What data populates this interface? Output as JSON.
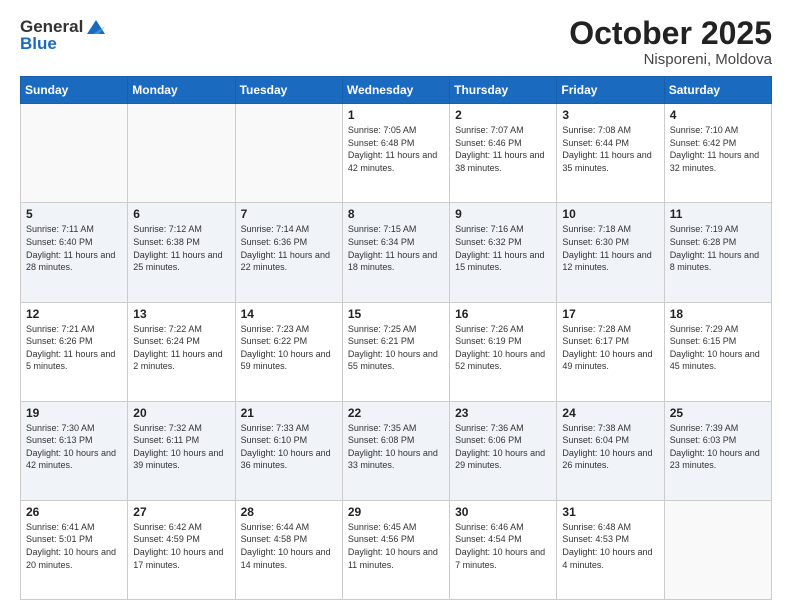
{
  "header": {
    "logo_general": "General",
    "logo_blue": "Blue",
    "title": "October 2025",
    "subtitle": "Nisporeni, Moldova"
  },
  "weekdays": [
    "Sunday",
    "Monday",
    "Tuesday",
    "Wednesday",
    "Thursday",
    "Friday",
    "Saturday"
  ],
  "weeks": [
    [
      {
        "day": "",
        "info": ""
      },
      {
        "day": "",
        "info": ""
      },
      {
        "day": "",
        "info": ""
      },
      {
        "day": "1",
        "info": "Sunrise: 7:05 AM\nSunset: 6:48 PM\nDaylight: 11 hours and 42 minutes."
      },
      {
        "day": "2",
        "info": "Sunrise: 7:07 AM\nSunset: 6:46 PM\nDaylight: 11 hours and 38 minutes."
      },
      {
        "day": "3",
        "info": "Sunrise: 7:08 AM\nSunset: 6:44 PM\nDaylight: 11 hours and 35 minutes."
      },
      {
        "day": "4",
        "info": "Sunrise: 7:10 AM\nSunset: 6:42 PM\nDaylight: 11 hours and 32 minutes."
      }
    ],
    [
      {
        "day": "5",
        "info": "Sunrise: 7:11 AM\nSunset: 6:40 PM\nDaylight: 11 hours and 28 minutes."
      },
      {
        "day": "6",
        "info": "Sunrise: 7:12 AM\nSunset: 6:38 PM\nDaylight: 11 hours and 25 minutes."
      },
      {
        "day": "7",
        "info": "Sunrise: 7:14 AM\nSunset: 6:36 PM\nDaylight: 11 hours and 22 minutes."
      },
      {
        "day": "8",
        "info": "Sunrise: 7:15 AM\nSunset: 6:34 PM\nDaylight: 11 hours and 18 minutes."
      },
      {
        "day": "9",
        "info": "Sunrise: 7:16 AM\nSunset: 6:32 PM\nDaylight: 11 hours and 15 minutes."
      },
      {
        "day": "10",
        "info": "Sunrise: 7:18 AM\nSunset: 6:30 PM\nDaylight: 11 hours and 12 minutes."
      },
      {
        "day": "11",
        "info": "Sunrise: 7:19 AM\nSunset: 6:28 PM\nDaylight: 11 hours and 8 minutes."
      }
    ],
    [
      {
        "day": "12",
        "info": "Sunrise: 7:21 AM\nSunset: 6:26 PM\nDaylight: 11 hours and 5 minutes."
      },
      {
        "day": "13",
        "info": "Sunrise: 7:22 AM\nSunset: 6:24 PM\nDaylight: 11 hours and 2 minutes."
      },
      {
        "day": "14",
        "info": "Sunrise: 7:23 AM\nSunset: 6:22 PM\nDaylight: 10 hours and 59 minutes."
      },
      {
        "day": "15",
        "info": "Sunrise: 7:25 AM\nSunset: 6:21 PM\nDaylight: 10 hours and 55 minutes."
      },
      {
        "day": "16",
        "info": "Sunrise: 7:26 AM\nSunset: 6:19 PM\nDaylight: 10 hours and 52 minutes."
      },
      {
        "day": "17",
        "info": "Sunrise: 7:28 AM\nSunset: 6:17 PM\nDaylight: 10 hours and 49 minutes."
      },
      {
        "day": "18",
        "info": "Sunrise: 7:29 AM\nSunset: 6:15 PM\nDaylight: 10 hours and 45 minutes."
      }
    ],
    [
      {
        "day": "19",
        "info": "Sunrise: 7:30 AM\nSunset: 6:13 PM\nDaylight: 10 hours and 42 minutes."
      },
      {
        "day": "20",
        "info": "Sunrise: 7:32 AM\nSunset: 6:11 PM\nDaylight: 10 hours and 39 minutes."
      },
      {
        "day": "21",
        "info": "Sunrise: 7:33 AM\nSunset: 6:10 PM\nDaylight: 10 hours and 36 minutes."
      },
      {
        "day": "22",
        "info": "Sunrise: 7:35 AM\nSunset: 6:08 PM\nDaylight: 10 hours and 33 minutes."
      },
      {
        "day": "23",
        "info": "Sunrise: 7:36 AM\nSunset: 6:06 PM\nDaylight: 10 hours and 29 minutes."
      },
      {
        "day": "24",
        "info": "Sunrise: 7:38 AM\nSunset: 6:04 PM\nDaylight: 10 hours and 26 minutes."
      },
      {
        "day": "25",
        "info": "Sunrise: 7:39 AM\nSunset: 6:03 PM\nDaylight: 10 hours and 23 minutes."
      }
    ],
    [
      {
        "day": "26",
        "info": "Sunrise: 6:41 AM\nSunset: 5:01 PM\nDaylight: 10 hours and 20 minutes."
      },
      {
        "day": "27",
        "info": "Sunrise: 6:42 AM\nSunset: 4:59 PM\nDaylight: 10 hours and 17 minutes."
      },
      {
        "day": "28",
        "info": "Sunrise: 6:44 AM\nSunset: 4:58 PM\nDaylight: 10 hours and 14 minutes."
      },
      {
        "day": "29",
        "info": "Sunrise: 6:45 AM\nSunset: 4:56 PM\nDaylight: 10 hours and 11 minutes."
      },
      {
        "day": "30",
        "info": "Sunrise: 6:46 AM\nSunset: 4:54 PM\nDaylight: 10 hours and 7 minutes."
      },
      {
        "day": "31",
        "info": "Sunrise: 6:48 AM\nSunset: 4:53 PM\nDaylight: 10 hours and 4 minutes."
      },
      {
        "day": "",
        "info": ""
      }
    ]
  ]
}
